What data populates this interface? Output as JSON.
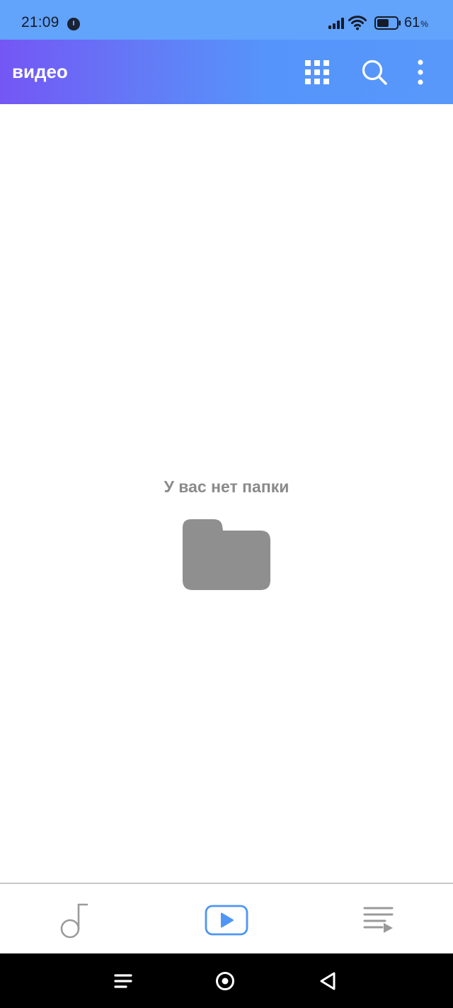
{
  "status_bar": {
    "time": "21:09",
    "battery_level": 61,
    "battery_number": "61",
    "battery_unit": "%"
  },
  "app_bar": {
    "title": "видео",
    "actions": [
      "grid-icon",
      "search-icon",
      "more-vertical-icon"
    ]
  },
  "empty_state": {
    "message": "У вас нет папки",
    "icon": "folder-icon"
  },
  "bottom_nav": {
    "tabs": [
      {
        "icon": "music-note-icon",
        "active": false
      },
      {
        "icon": "video-play-icon",
        "active": true
      },
      {
        "icon": "playlist-icon",
        "active": false
      }
    ]
  },
  "colors": {
    "status_bar": "#62a3fb",
    "app_bar_start": "#7456f5",
    "app_bar_end": "#5898fb",
    "active_tab": "#4f95f5",
    "inactive_tab": "#9a9a9a",
    "empty_state": "#8a8a8a"
  }
}
